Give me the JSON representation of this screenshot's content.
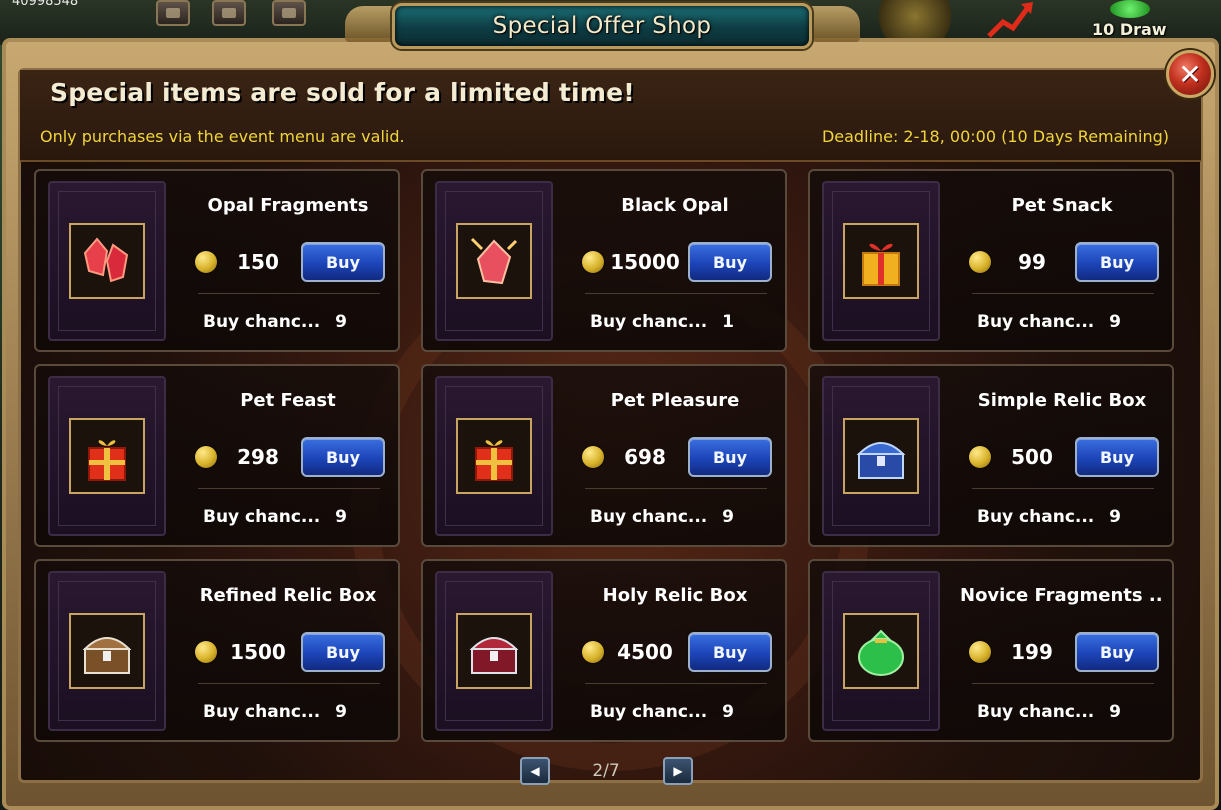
{
  "hud": {
    "currency_number": "40998548",
    "draw_label": "10 Draw"
  },
  "window": {
    "title": "Special Offer Shop",
    "close_label": "✕",
    "headline": "Special items are sold for a limited time!",
    "note": "Only purchases via the event menu are valid.",
    "deadline": "Deadline: 2-18, 00:00 (10 Days Remaining)"
  },
  "items": [
    {
      "name": "Opal Fragments",
      "price": "150",
      "buy_label": "Buy",
      "chance_label": "Buy chanc...",
      "chance_value": "9",
      "icon": "opal-fragments-icon",
      "color": "#e8404a"
    },
    {
      "name": "Black Opal",
      "price": "15000",
      "buy_label": "Buy",
      "chance_label": "Buy chanc...",
      "chance_value": "1",
      "icon": "black-opal-icon",
      "color": "#e85060"
    },
    {
      "name": "Pet Snack",
      "price": "99",
      "buy_label": "Buy",
      "chance_label": "Buy chanc...",
      "chance_value": "9",
      "icon": "gift-box-icon",
      "color": "#f0b020"
    },
    {
      "name": "Pet Feast",
      "price": "298",
      "buy_label": "Buy",
      "chance_label": "Buy chanc...",
      "chance_value": "9",
      "icon": "gift-box-icon",
      "color": "#e0301a"
    },
    {
      "name": "Pet Pleasure",
      "price": "698",
      "buy_label": "Buy",
      "chance_label": "Buy chanc...",
      "chance_value": "9",
      "icon": "gift-box-icon",
      "color": "#e0301a"
    },
    {
      "name": "Simple Relic Box",
      "price": "500",
      "buy_label": "Buy",
      "chance_label": "Buy chanc...",
      "chance_value": "9",
      "icon": "chest-icon",
      "color": "#3a6ad0"
    },
    {
      "name": "Refined Relic Box",
      "price": "1500",
      "buy_label": "Buy",
      "chance_label": "Buy chanc...",
      "chance_value": "9",
      "icon": "chest-icon",
      "color": "#a07040"
    },
    {
      "name": "Holy Relic Box",
      "price": "4500",
      "buy_label": "Buy",
      "chance_label": "Buy chanc...",
      "chance_value": "9",
      "icon": "chest-icon",
      "color": "#b0283a"
    },
    {
      "name": "Novice Fragments ...",
      "price": "199",
      "buy_label": "Buy",
      "chance_label": "Buy chanc...",
      "chance_value": "9",
      "icon": "sack-icon",
      "color": "#2cc04a"
    }
  ],
  "pagination": {
    "page": "2/7",
    "prev_label": "◀",
    "next_label": "▶"
  }
}
